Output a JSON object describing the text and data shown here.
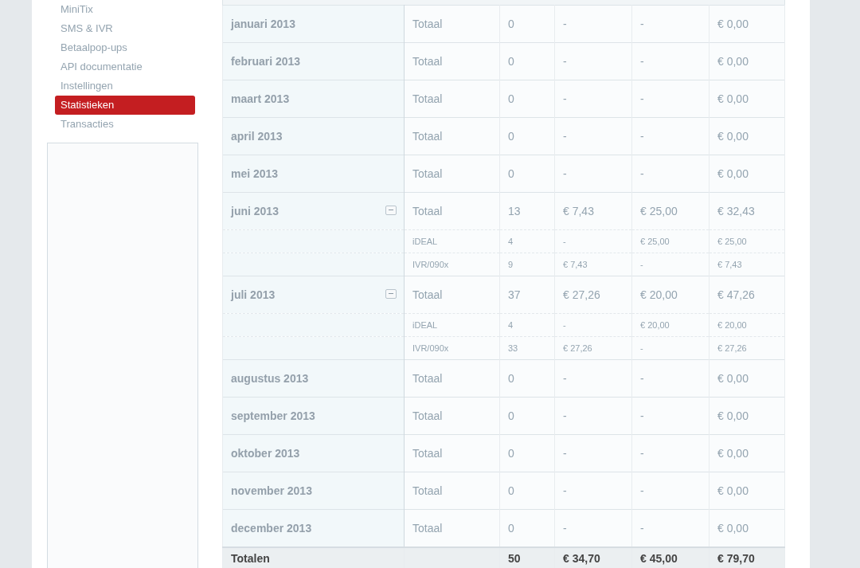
{
  "sidebar": {
    "items": [
      {
        "label": "MiniTix",
        "selected": false
      },
      {
        "label": "SMS & IVR",
        "selected": false
      },
      {
        "label": "Betaalpop-ups",
        "selected": false
      },
      {
        "label": "API documentatie",
        "selected": false
      },
      {
        "label": "Instellingen",
        "selected": false
      },
      {
        "label": "Statistieken",
        "selected": true
      },
      {
        "label": "Transacties",
        "selected": false
      }
    ]
  },
  "table": {
    "rows": [
      {
        "month": "januari 2013",
        "lines": [
          {
            "label": "Totaal",
            "column_3": "0",
            "column_4": "-",
            "column_5": "-",
            "column_6": "€ 0,00"
          }
        ]
      },
      {
        "month": "februari 2013",
        "lines": [
          {
            "label": "Totaal",
            "column_3": "0",
            "column_4": "-",
            "column_5": "-",
            "column_6": "€ 0,00"
          }
        ]
      },
      {
        "month": "maart 2013",
        "lines": [
          {
            "label": "Totaal",
            "column_3": "0",
            "column_4": "-",
            "column_5": "-",
            "column_6": "€ 0,00"
          }
        ]
      },
      {
        "month": "april 2013",
        "lines": [
          {
            "label": "Totaal",
            "column_3": "0",
            "column_4": "-",
            "column_5": "-",
            "column_6": "€ 0,00"
          }
        ]
      },
      {
        "month": "mei 2013",
        "lines": [
          {
            "label": "Totaal",
            "column_3": "0",
            "column_4": "-",
            "column_5": "-",
            "column_6": "€ 0,00"
          }
        ]
      },
      {
        "month": "juni 2013",
        "expanded": true,
        "lines": [
          {
            "label": "Totaal",
            "column_3": "13",
            "column_4": "€ 7,43",
            "column_5": "€ 25,00",
            "column_6": "€ 32,43"
          },
          {
            "label": "iDEAL",
            "column_3": "4",
            "column_4": "-",
            "column_5": "€ 25,00",
            "column_6": "€ 25,00"
          },
          {
            "label": "IVR/090x",
            "column_3": "9",
            "column_4": "€ 7,43",
            "column_5": "-",
            "column_6": "€ 7,43"
          }
        ]
      },
      {
        "month": "juli 2013",
        "expanded": true,
        "lines": [
          {
            "label": "Totaal",
            "column_3": "37",
            "column_4": "€ 27,26",
            "column_5": "€ 20,00",
            "column_6": "€ 47,26"
          },
          {
            "label": "iDEAL",
            "column_3": "4",
            "column_4": "-",
            "column_5": "€ 20,00",
            "column_6": "€ 20,00"
          },
          {
            "label": "IVR/090x",
            "column_3": "33",
            "column_4": "€ 27,26",
            "column_5": "-",
            "column_6": "€ 27,26"
          }
        ]
      },
      {
        "month": "augustus 2013",
        "lines": [
          {
            "label": "Totaal",
            "column_3": "0",
            "column_4": "-",
            "column_5": "-",
            "column_6": "€ 0,00"
          }
        ]
      },
      {
        "month": "september 2013",
        "lines": [
          {
            "label": "Totaal",
            "column_3": "0",
            "column_4": "-",
            "column_5": "-",
            "column_6": "€ 0,00"
          }
        ]
      },
      {
        "month": "oktober 2013",
        "lines": [
          {
            "label": "Totaal",
            "column_3": "0",
            "column_4": "-",
            "column_5": "-",
            "column_6": "€ 0,00"
          }
        ]
      },
      {
        "month": "november 2013",
        "lines": [
          {
            "label": "Totaal",
            "column_3": "0",
            "column_4": "-",
            "column_5": "-",
            "column_6": "€ 0,00"
          }
        ]
      },
      {
        "month": "december 2013",
        "lines": [
          {
            "label": "Totaal",
            "column_3": "0",
            "column_4": "-",
            "column_5": "-",
            "column_6": "€ 0,00"
          }
        ]
      }
    ],
    "totals": {
      "label": "Totalen",
      "column_3": "50",
      "column_4": "€ 34,70",
      "column_5": "€ 45,00",
      "column_6": "€ 79,70"
    }
  }
}
